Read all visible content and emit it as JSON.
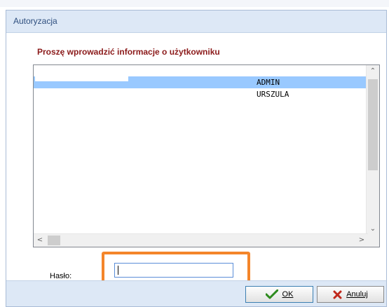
{
  "window": {
    "title": "Autoryzacja"
  },
  "section": {
    "label": "Proszę wprowadzić informacje o użytkowniku"
  },
  "user_list": {
    "rows": [
      {
        "name": "",
        "login": "ADMIN",
        "selected": true
      },
      {
        "name": "",
        "login": "URSZULA",
        "selected": false
      }
    ]
  },
  "scrollbars": {
    "up_arrow": "⌃",
    "down_arrow": "⌄",
    "left_arrow": "<",
    "right_arrow": ">"
  },
  "password": {
    "label": "Hasło:",
    "value": ""
  },
  "buttons": {
    "ok": {
      "label": "OK",
      "icon": "checkmark-icon",
      "color": "#2e8b1e"
    },
    "cancel": {
      "label": "Anuluj",
      "icon": "x-icon",
      "color": "#c0281c"
    }
  },
  "colors": {
    "highlight_frame": "#f4852a",
    "selected_row": "#99c9ff",
    "section_label": "#8b1a1a"
  }
}
